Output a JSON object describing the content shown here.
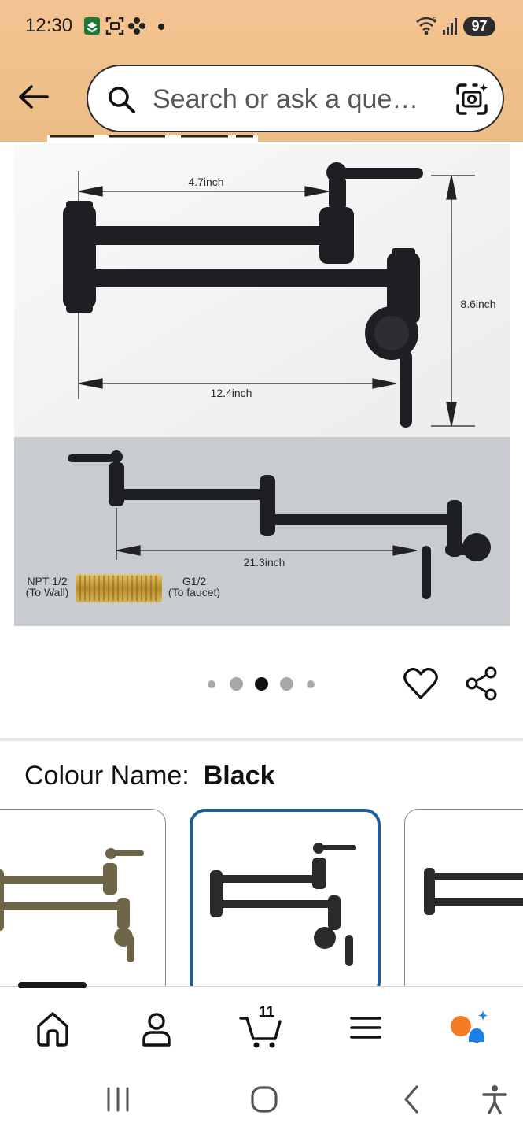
{
  "status_bar": {
    "time": "12:30",
    "battery": "97",
    "icons": [
      "app-notification-icon",
      "screenshot-icon",
      "flower-icon",
      "dot-icon",
      "wifi-icon",
      "signal-icon"
    ]
  },
  "search": {
    "placeholder": "Search or ask a que…",
    "icons": [
      "back-arrow-icon",
      "search-icon",
      "camera-lens-icon"
    ]
  },
  "product_image": {
    "dimensions": {
      "top_arm": "4.7inch",
      "height": "8.6inch",
      "lower_arm": "12.4inch",
      "extended": "21.3inch"
    },
    "adapter": {
      "left_label": "NPT 1/2",
      "left_sub": "(To Wall)",
      "right_label": "G1/2",
      "right_sub": "(To faucet)"
    },
    "carousel_index": 3,
    "carousel_total": 5
  },
  "actions": [
    "heart-icon",
    "share-icon"
  ],
  "colour": {
    "label": "Colour Name:",
    "value": "Black",
    "swatches": [
      {
        "name": "Bronze",
        "color": "#6e6447",
        "selected": false
      },
      {
        "name": "Black",
        "color": "#2a2a2a",
        "selected": true
      },
      {
        "name": "Black (partial)",
        "color": "#2a2a2a",
        "selected": false
      }
    ]
  },
  "bottom_nav": {
    "items": [
      "home-icon",
      "account-icon",
      "cart-icon",
      "menu-icon",
      "rufus-icon"
    ],
    "cart_count": "11"
  },
  "system_nav": [
    "recent-apps-icon",
    "home-button-icon",
    "back-icon",
    "accessibility-icon"
  ],
  "colors": {
    "header_bg": "#efc08b",
    "selected_border": "#1f5e9a",
    "faucet": "#1d1f22",
    "bronze": "#6e6447",
    "brass": "#c9a44a",
    "rufus_orange": "#f57c22",
    "rufus_blue": "#1a7fe8"
  }
}
